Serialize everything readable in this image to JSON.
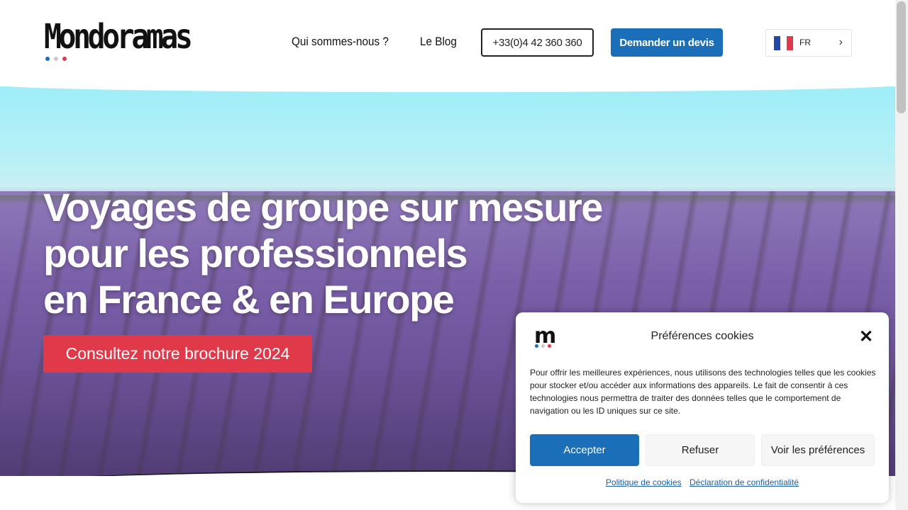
{
  "header": {
    "logo_text": "Mondoramas",
    "logo_dot_colors": [
      "#1b6eb8",
      "#c9c9c9",
      "#e0394a"
    ],
    "nav": [
      {
        "label": "Qui sommes-nous ?"
      },
      {
        "label": "Le Blog"
      }
    ],
    "phone_label": "+33(0)4 42 360 360",
    "quote_label": "Demander un devis",
    "language": {
      "code": "FR",
      "flag_colors": [
        "#1f48a8",
        "#ffffff",
        "#e0394a"
      ]
    }
  },
  "hero": {
    "title_lines": [
      "Voyages de groupe sur mesure",
      "pour les professionnels",
      "en France & en Europe"
    ],
    "brochure_label": "Consultez notre brochure 2024"
  },
  "cookie_dialog": {
    "logo_letter": "m",
    "title": "Préférences cookies",
    "close_symbol": "✕",
    "body": "Pour offrir les meilleures expériences, nous utilisons des technologies telles que les cookies pour stocker et/ou accéder aux informations des appareils. Le fait de consentir à ces technologies nous permettra de traiter des données telles que le comportement de navigation ou les ID uniques sur ce site.",
    "accept_label": "Accepter",
    "refuse_label": "Refuser",
    "preferences_label": "Voir les préférences",
    "links": [
      {
        "label": "Politique de cookies"
      },
      {
        "label": "Déclaration de confidentialité"
      }
    ]
  },
  "colors": {
    "primary_blue": "#1b6eb8",
    "brochure_red": "#e0394a"
  }
}
